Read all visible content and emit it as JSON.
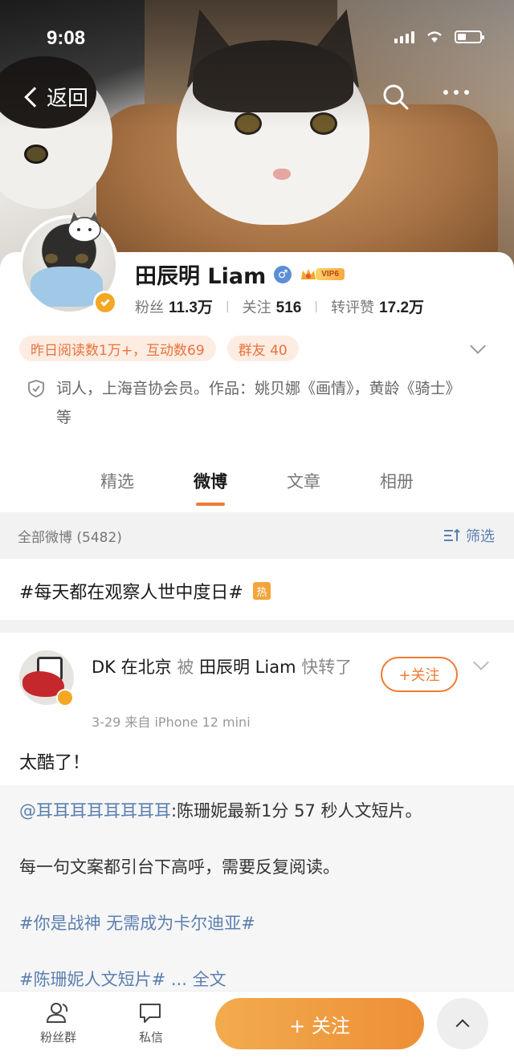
{
  "status_bar": {
    "time": "9:08"
  },
  "nav": {
    "back_label": "返回"
  },
  "profile": {
    "name": "田辰明 Liam",
    "vip_label": "VIP6",
    "stats": [
      {
        "label": "粉丝",
        "value": "11.3万"
      },
      {
        "label": "关注",
        "value": "516"
      },
      {
        "label": "转评赞",
        "value": "17.2万"
      }
    ],
    "pills": [
      "昨日阅读数1万+，互动数69",
      "群友 40"
    ],
    "bio": "词人，上海音协会员。作品：姚贝娜《画情》，黄龄《骑士》等"
  },
  "tabs": [
    "精选",
    "微博",
    "文章",
    "相册"
  ],
  "active_tab": "微博",
  "filter_bar": {
    "all_label": "全部微博 (5482)",
    "filter_label": "筛选"
  },
  "topic": {
    "text": "#每天都在观察人世中度日#",
    "hot_label": "热"
  },
  "post": {
    "author": "DK 在北京",
    "by_label": "被",
    "reposter": "田辰明 Liam",
    "action": "快转了",
    "meta": "3-29  来自 iPhone 12 mini",
    "follow_label": "+关注",
    "text": "太酷了！",
    "repost": {
      "mention": "@耳耳耳耳耳耳耳耳",
      "line1": ":陈珊妮最新1分 57 秒人文短片。",
      "line2": "每一句文案都引台下高呼，需要反复阅读。",
      "tag1": "#你是战神 无需成为卡尔迪亚#",
      "tag2": "#陈珊妮人文短片#",
      "more": " ... 全文"
    }
  },
  "bottom_bar": {
    "fans_group": "粉丝群",
    "message": "私信",
    "follow": "+ 关注"
  },
  "colors": {
    "accent": "#f07a30",
    "link": "#5a7fb0"
  }
}
